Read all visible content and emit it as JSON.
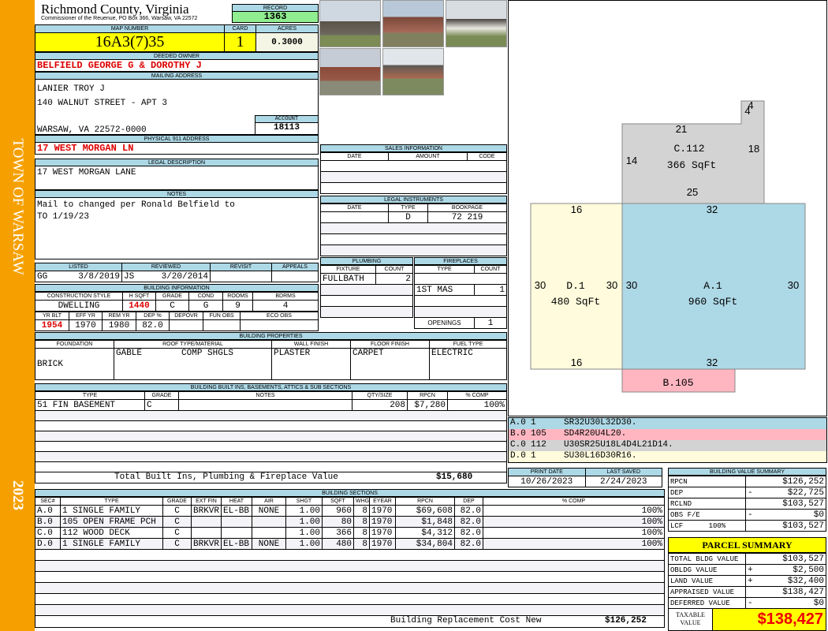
{
  "sidebar": {
    "town": "TOWN OF WARSAW",
    "year": "2023"
  },
  "header": {
    "county": "Richmond County, Virginia",
    "office": "Commissioner of the Reuenue, PO Box 366, Warsaw, VA 22572",
    "record_label": "RECORD",
    "record": "1363",
    "map_label": "MAP NUMBER",
    "map": "16A3(7)35",
    "card_label": "CARD",
    "card": "1",
    "acres_label": "ACRES",
    "acres": "0.3000"
  },
  "owner": {
    "label": "DEEDED OWNER",
    "name": "BELFIELD GEORGE G & DOROTHY J",
    "mail_label": "MAILING ADDRESS",
    "mail1": "LANIER TROY J",
    "mail2": "140 WALNUT STREET - APT 3",
    "mail3": "WARSAW, VA 22572-0000",
    "account_label": "ACCOUNT",
    "account": "18113",
    "phys_label": "PHYSICAL 911 ADDRESS",
    "phys": "17 WEST MORGAN LN"
  },
  "legal": {
    "label": "LEGAL DESCRIPTION",
    "text": "17 WEST MORGAN LANE"
  },
  "notes": {
    "label": "NOTES",
    "line1": "Mail to changed per Ronald Belfield to",
    "line2": "TO 1/19/23"
  },
  "listing": {
    "h": [
      "LISTED",
      "REVIEWED",
      "REVISIT",
      "APPEALS"
    ],
    "listed_by": "GG",
    "listed": "3/8/2019",
    "reviewed_by": "JS",
    "reviewed": "3/20/2014"
  },
  "bldg": {
    "label": "BUILDING INFORMATION",
    "h1": [
      "CONSTRUCTION STYLE",
      "H SQFT",
      "GRADE",
      "COND",
      "ROOMS",
      "BDRMS"
    ],
    "v1": [
      "DWELLING",
      "1440",
      "C",
      "G",
      "9",
      "4"
    ],
    "h2": [
      "YR BLT",
      "EFF YR",
      "REM YR",
      "DEP %",
      "DEPOVR",
      "FUN OBS",
      "ECO OBS"
    ],
    "v2": [
      "1954",
      "1970",
      "1980",
      "82.0",
      "",
      "",
      ""
    ]
  },
  "sales": {
    "label": "SALES INFORMATION",
    "h": [
      "DATE",
      "AMOUNT",
      "CODE"
    ]
  },
  "instruments": {
    "label": "LEGAL INSTRUMENTS",
    "h": [
      "DATE",
      "TYPE",
      "BOOKPAGE"
    ],
    "type": "D",
    "bookpage": "72 219"
  },
  "plumbing": {
    "label": "PLUMBING",
    "h": [
      "FIXTURE",
      "COUNT"
    ],
    "fixture": "FULLBATH",
    "count": "2"
  },
  "fireplaces": {
    "label": "FIREPLACES",
    "h": [
      "TYPE",
      "COUNT"
    ],
    "type": "1ST MAS",
    "count": "1",
    "openings_label": "OPENINGS",
    "openings": "1"
  },
  "props": {
    "label": "BUILDING PROPERTIES",
    "h": [
      "FOUNDATION",
      "ROOF TYPE/MATERIAL",
      "WALL FINISH",
      "FLOOR FINISH",
      "FUEL TYPE"
    ],
    "foundation": "BRICK",
    "roof_type": "GABLE",
    "roof_mat": "COMP SHGLS",
    "wall": "PLASTER",
    "floor": "CARPET",
    "fuel": "ELECTRIC"
  },
  "builtins": {
    "label": "BUILDING BUILT INS, BASEMENTS, ATTICS & SUB SECTIONS",
    "h": [
      "TYPE",
      "GRADE",
      "NOTES",
      "QTY/SIZE",
      "RPCN",
      "% COMP"
    ],
    "rows": [
      [
        "51 FIN BASEMENT",
        "C",
        "",
        "208",
        "$7,280",
        "100%"
      ]
    ],
    "total_label": "Total Built Ins, Plumbing & Fireplace Value",
    "total": "$15,680"
  },
  "sections": {
    "label": "BUILDING SECTIONS",
    "h": [
      "SEC#",
      "TYPE",
      "GRADE",
      "EXT FIN",
      "HEAT",
      "AIR",
      "SHGT",
      "SQFT",
      "WHGT",
      "EYEAR",
      "RPCN",
      "DEP",
      "% COMP"
    ],
    "rows": [
      [
        "A.0",
        "1 SINGLE FAMILY",
        "C",
        "BRKVR",
        "EL-BB",
        "NONE",
        "1.00",
        "960",
        "8",
        "1970",
        "$69,608",
        "82.0",
        "100%"
      ],
      [
        "B.0",
        "105 OPEN FRAME PCH",
        "C",
        "",
        "",
        "",
        "1.00",
        "80",
        "8",
        "1970",
        "$1,848",
        "82.0",
        "100%"
      ],
      [
        "C.0",
        "112 WOOD DECK",
        "C",
        "",
        "",
        "",
        "1.00",
        "366",
        "8",
        "1970",
        "$4,312",
        "82.0",
        "100%"
      ],
      [
        "D.0",
        "1 SINGLE FAMILY",
        "C",
        "BRKVR",
        "EL-BB",
        "NONE",
        "1.00",
        "480",
        "8",
        "1970",
        "$34,804",
        "82.0",
        "100%"
      ]
    ],
    "total_label": "Building Replacement Cost New",
    "total": "$126,252"
  },
  "sketch": {
    "labels": {
      "A": "A.1",
      "A_area": "960 SqFt",
      "B": "B.105",
      "C": "C.112",
      "C_area": "366 SqFt",
      "D": "D.1",
      "D_area": "480 SqFt"
    },
    "dims": {
      "a_top": "32",
      "a_bottom": "32",
      "a_left": "30",
      "a_right": "30",
      "d_top": "16",
      "d_bottom": "16",
      "d_left": "30",
      "d_right": "30",
      "c_top": "21",
      "c_left": "14",
      "c_right": "18",
      "c_bottom": "25",
      "c_notch_w": "4",
      "c_notch_h": "4"
    },
    "colors": {
      "A": "#add8e6",
      "B": "#ffb6c1",
      "C": "#d3d3d3",
      "D": "#fffbdc"
    },
    "vectors": [
      [
        "A.0",
        "1",
        "SR32U30L32D30."
      ],
      [
        "B.0",
        "105",
        "SD4R20U4L20."
      ],
      [
        "C.0",
        "112",
        "U30SR25U18L4D4L21D14."
      ],
      [
        "D.0",
        "1",
        "SU30L16D30R16."
      ]
    ]
  },
  "dates": {
    "print_label": "PRINT DATE",
    "print": "10/26/2023",
    "saved_label": "LAST SAVED",
    "saved": "2/24/2023"
  },
  "value_summary": {
    "label": "BUILDING VALUE SUMMARY",
    "rows": [
      [
        "RPCN",
        "",
        "$126,252"
      ],
      [
        "DEP",
        "-",
        "$22,725"
      ],
      [
        "RCLND",
        "",
        "$103,527"
      ],
      [
        "OBS F/E",
        "-",
        "$0"
      ],
      [
        "LCF      100%",
        "",
        "$103,527"
      ]
    ]
  },
  "parcel": {
    "label": "PARCEL SUMMARY",
    "rows": [
      [
        "TOTAL BLDG VALUE",
        "",
        "$103,527"
      ],
      [
        "OBLDG VALUE",
        "+",
        "$2,500"
      ],
      [
        "LAND VALUE",
        "+",
        "$32,400"
      ],
      [
        "APPRAISED VALUE",
        "",
        "$138,427"
      ],
      [
        "DEFERRED VALUE",
        "-",
        "$0"
      ]
    ],
    "taxable_label": "TAXABLE VALUE",
    "taxable": "$138,427"
  }
}
